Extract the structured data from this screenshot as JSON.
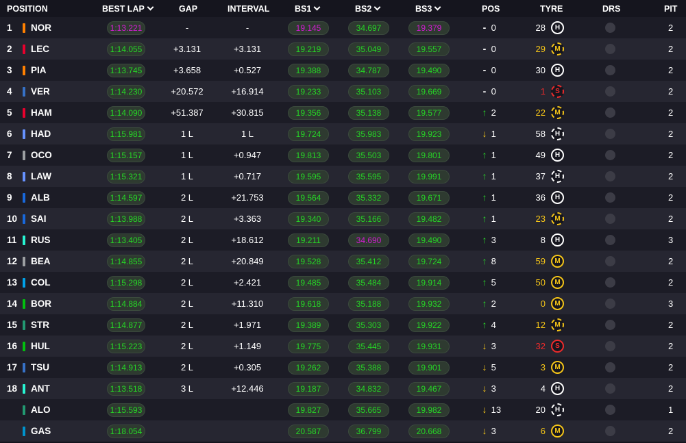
{
  "headers": {
    "position": "POSITION",
    "best_lap": "BEST LAP",
    "gap": "GAP",
    "interval": "INTERVAL",
    "bs1": "BS1",
    "bs2": "BS2",
    "bs3": "BS3",
    "pos": "POS",
    "tyre": "TYRE",
    "drs": "DRS",
    "pit": "PIT"
  },
  "colors": {
    "background": "#15151e",
    "green": "#26d626",
    "purple": "#d31dd3",
    "medium": "#f5c518",
    "soft": "#ee2b2b",
    "hard": "#ffffff"
  },
  "drivers": [
    {
      "position": "1",
      "code": "NOR",
      "team_color": "#ff8000",
      "best_lap": "1:13.221",
      "best_lap_color": "purple",
      "gap": "-",
      "interval": "-",
      "bs1": "19.145",
      "bs1_color": "purple",
      "bs2": "34.697",
      "bs2_color": "green",
      "bs3": "19.379",
      "bs3_color": "purple",
      "pos_change_dir": "none",
      "pos_change_symbol": "-",
      "pos_change": "0",
      "tyre_laps": "28",
      "tyre_compound": "H",
      "tyre_used": false,
      "pit": "2"
    },
    {
      "position": "2",
      "code": "LEC",
      "team_color": "#e8002d",
      "best_lap": "1:14.055",
      "best_lap_color": "green",
      "gap": "+3.131",
      "interval": "+3.131",
      "bs1": "19.219",
      "bs1_color": "green",
      "bs2": "35.049",
      "bs2_color": "green",
      "bs3": "19.557",
      "bs3_color": "green",
      "pos_change_dir": "none",
      "pos_change_symbol": "-",
      "pos_change": "0",
      "tyre_laps": "29",
      "tyre_compound": "M",
      "tyre_used": true,
      "pit": "2"
    },
    {
      "position": "3",
      "code": "PIA",
      "team_color": "#ff8000",
      "best_lap": "1:13.745",
      "best_lap_color": "green",
      "gap": "+3.658",
      "interval": "+0.527",
      "bs1": "19.388",
      "bs1_color": "green",
      "bs2": "34.787",
      "bs2_color": "green",
      "bs3": "19.490",
      "bs3_color": "green",
      "pos_change_dir": "none",
      "pos_change_symbol": "-",
      "pos_change": "0",
      "tyre_laps": "30",
      "tyre_compound": "H",
      "tyre_used": false,
      "pit": "2"
    },
    {
      "position": "4",
      "code": "VER",
      "team_color": "#3671c6",
      "best_lap": "1:14.230",
      "best_lap_color": "green",
      "gap": "+20.572",
      "interval": "+16.914",
      "bs1": "19.233",
      "bs1_color": "green",
      "bs2": "35.103",
      "bs2_color": "green",
      "bs3": "19.669",
      "bs3_color": "green",
      "pos_change_dir": "none",
      "pos_change_symbol": "-",
      "pos_change": "0",
      "tyre_laps": "1",
      "tyre_compound": "S",
      "tyre_used": true,
      "pit": "2"
    },
    {
      "position": "5",
      "code": "HAM",
      "team_color": "#e8002d",
      "best_lap": "1:14.090",
      "best_lap_color": "green",
      "gap": "+51.387",
      "interval": "+30.815",
      "bs1": "19.356",
      "bs1_color": "green",
      "bs2": "35.138",
      "bs2_color": "green",
      "bs3": "19.577",
      "bs3_color": "green",
      "pos_change_dir": "up",
      "pos_change_symbol": "↑",
      "pos_change": "2",
      "tyre_laps": "22",
      "tyre_compound": "M",
      "tyre_used": true,
      "pit": "2"
    },
    {
      "position": "6",
      "code": "HAD",
      "team_color": "#6692ff",
      "best_lap": "1:15.981",
      "best_lap_color": "green",
      "gap": "1 L",
      "interval": "1 L",
      "bs1": "19.724",
      "bs1_color": "green",
      "bs2": "35.983",
      "bs2_color": "green",
      "bs3": "19.923",
      "bs3_color": "green",
      "pos_change_dir": "down",
      "pos_change_symbol": "↓",
      "pos_change": "1",
      "tyre_laps": "58",
      "tyre_compound": "H",
      "tyre_used": true,
      "pit": "2"
    },
    {
      "position": "7",
      "code": "OCO",
      "team_color": "#9c9fa2",
      "best_lap": "1:15.157",
      "best_lap_color": "green",
      "gap": "1 L",
      "interval": "+0.947",
      "bs1": "19.813",
      "bs1_color": "green",
      "bs2": "35.503",
      "bs2_color": "green",
      "bs3": "19.801",
      "bs3_color": "green",
      "pos_change_dir": "up",
      "pos_change_symbol": "↑",
      "pos_change": "1",
      "tyre_laps": "49",
      "tyre_compound": "H",
      "tyre_used": false,
      "pit": "2"
    },
    {
      "position": "8",
      "code": "LAW",
      "team_color": "#6692ff",
      "best_lap": "1:15.321",
      "best_lap_color": "green",
      "gap": "1 L",
      "interval": "+0.717",
      "bs1": "19.595",
      "bs1_color": "green",
      "bs2": "35.595",
      "bs2_color": "green",
      "bs3": "19.991",
      "bs3_color": "green",
      "pos_change_dir": "up",
      "pos_change_symbol": "↑",
      "pos_change": "1",
      "tyre_laps": "37",
      "tyre_compound": "H",
      "tyre_used": true,
      "pit": "2"
    },
    {
      "position": "9",
      "code": "ALB",
      "team_color": "#1868db",
      "best_lap": "1:14.597",
      "best_lap_color": "green",
      "gap": "2 L",
      "interval": "+21.753",
      "bs1": "19.564",
      "bs1_color": "green",
      "bs2": "35.332",
      "bs2_color": "green",
      "bs3": "19.671",
      "bs3_color": "green",
      "pos_change_dir": "up",
      "pos_change_symbol": "↑",
      "pos_change": "1",
      "tyre_laps": "36",
      "tyre_compound": "H",
      "tyre_used": false,
      "pit": "2"
    },
    {
      "position": "10",
      "code": "SAI",
      "team_color": "#1868db",
      "best_lap": "1:13.988",
      "best_lap_color": "green",
      "gap": "2 L",
      "interval": "+3.363",
      "bs1": "19.340",
      "bs1_color": "green",
      "bs2": "35.166",
      "bs2_color": "green",
      "bs3": "19.482",
      "bs3_color": "green",
      "pos_change_dir": "up",
      "pos_change_symbol": "↑",
      "pos_change": "1",
      "tyre_laps": "23",
      "tyre_compound": "M",
      "tyre_used": true,
      "pit": "2"
    },
    {
      "position": "11",
      "code": "RUS",
      "team_color": "#27f4d2",
      "best_lap": "1:13.405",
      "best_lap_color": "green",
      "gap": "2 L",
      "interval": "+18.612",
      "bs1": "19.211",
      "bs1_color": "green",
      "bs2": "34.690",
      "bs2_color": "purple",
      "bs3": "19.490",
      "bs3_color": "green",
      "pos_change_dir": "up",
      "pos_change_symbol": "↑",
      "pos_change": "3",
      "tyre_laps": "8",
      "tyre_compound": "H",
      "tyre_used": false,
      "pit": "3"
    },
    {
      "position": "12",
      "code": "BEA",
      "team_color": "#9c9fa2",
      "best_lap": "1:14.855",
      "best_lap_color": "green",
      "gap": "2 L",
      "interval": "+20.849",
      "bs1": "19.528",
      "bs1_color": "green",
      "bs2": "35.412",
      "bs2_color": "green",
      "bs3": "19.724",
      "bs3_color": "green",
      "pos_change_dir": "up",
      "pos_change_symbol": "↑",
      "pos_change": "8",
      "tyre_laps": "59",
      "tyre_compound": "M",
      "tyre_used": false,
      "pit": "2"
    },
    {
      "position": "13",
      "code": "COL",
      "team_color": "#00a1e8",
      "best_lap": "1:15.298",
      "best_lap_color": "green",
      "gap": "2 L",
      "interval": "+2.421",
      "bs1": "19.485",
      "bs1_color": "green",
      "bs2": "35.484",
      "bs2_color": "green",
      "bs3": "19.914",
      "bs3_color": "green",
      "pos_change_dir": "up",
      "pos_change_symbol": "↑",
      "pos_change": "5",
      "tyre_laps": "50",
      "tyre_compound": "M",
      "tyre_used": false,
      "pit": "2"
    },
    {
      "position": "14",
      "code": "BOR",
      "team_color": "#01c00e",
      "best_lap": "1:14.884",
      "best_lap_color": "green",
      "gap": "2 L",
      "interval": "+11.310",
      "bs1": "19.618",
      "bs1_color": "green",
      "bs2": "35.188",
      "bs2_color": "green",
      "bs3": "19.932",
      "bs3_color": "green",
      "pos_change_dir": "up",
      "pos_change_symbol": "↑",
      "pos_change": "2",
      "tyre_laps": "0",
      "tyre_compound": "M",
      "tyre_used": false,
      "pit": "3"
    },
    {
      "position": "15",
      "code": "STR",
      "team_color": "#229971",
      "best_lap": "1:14.877",
      "best_lap_color": "green",
      "gap": "2 L",
      "interval": "+1.971",
      "bs1": "19.389",
      "bs1_color": "green",
      "bs2": "35.303",
      "bs2_color": "green",
      "bs3": "19.922",
      "bs3_color": "green",
      "pos_change_dir": "up",
      "pos_change_symbol": "↑",
      "pos_change": "4",
      "tyre_laps": "12",
      "tyre_compound": "M",
      "tyre_used": true,
      "pit": "2"
    },
    {
      "position": "16",
      "code": "HUL",
      "team_color": "#01c00e",
      "best_lap": "1:15.223",
      "best_lap_color": "green",
      "gap": "2 L",
      "interval": "+1.149",
      "bs1": "19.775",
      "bs1_color": "green",
      "bs2": "35.445",
      "bs2_color": "green",
      "bs3": "19.931",
      "bs3_color": "green",
      "pos_change_dir": "down",
      "pos_change_symbol": "↓",
      "pos_change": "3",
      "tyre_laps": "32",
      "tyre_compound": "S",
      "tyre_used": false,
      "pit": "2"
    },
    {
      "position": "17",
      "code": "TSU",
      "team_color": "#3671c6",
      "best_lap": "1:14.913",
      "best_lap_color": "green",
      "gap": "2 L",
      "interval": "+0.305",
      "bs1": "19.262",
      "bs1_color": "green",
      "bs2": "35.388",
      "bs2_color": "green",
      "bs3": "19.901",
      "bs3_color": "green",
      "pos_change_dir": "down",
      "pos_change_symbol": "↓",
      "pos_change": "5",
      "tyre_laps": "3",
      "tyre_compound": "M",
      "tyre_used": false,
      "pit": "2"
    },
    {
      "position": "18",
      "code": "ANT",
      "team_color": "#27f4d2",
      "best_lap": "1:13.518",
      "best_lap_color": "green",
      "gap": "3 L",
      "interval": "+12.446",
      "bs1": "19.187",
      "bs1_color": "green",
      "bs2": "34.832",
      "bs2_color": "green",
      "bs3": "19.467",
      "bs3_color": "green",
      "pos_change_dir": "down",
      "pos_change_symbol": "↓",
      "pos_change": "3",
      "tyre_laps": "4",
      "tyre_compound": "H",
      "tyre_used": false,
      "pit": "2"
    },
    {
      "position": "",
      "code": "ALO",
      "team_color": "#229971",
      "best_lap": "1:15.593",
      "best_lap_color": "green",
      "gap": "",
      "interval": "",
      "bs1": "19.827",
      "bs1_color": "green",
      "bs2": "35.665",
      "bs2_color": "green",
      "bs3": "19.982",
      "bs3_color": "green",
      "pos_change_dir": "down",
      "pos_change_symbol": "↓",
      "pos_change": "13",
      "tyre_laps": "20",
      "tyre_compound": "H",
      "tyre_used": true,
      "pit": "1"
    },
    {
      "position": "",
      "code": "GAS",
      "team_color": "#0093cc",
      "best_lap": "1:18.054",
      "best_lap_color": "green",
      "gap": "",
      "interval": "",
      "bs1": "20.587",
      "bs1_color": "green",
      "bs2": "36.799",
      "bs2_color": "green",
      "bs3": "20.668",
      "bs3_color": "green",
      "pos_change_dir": "down",
      "pos_change_symbol": "↓",
      "pos_change": "3",
      "tyre_laps": "6",
      "tyre_compound": "M",
      "tyre_used": false,
      "pit": "2"
    }
  ]
}
